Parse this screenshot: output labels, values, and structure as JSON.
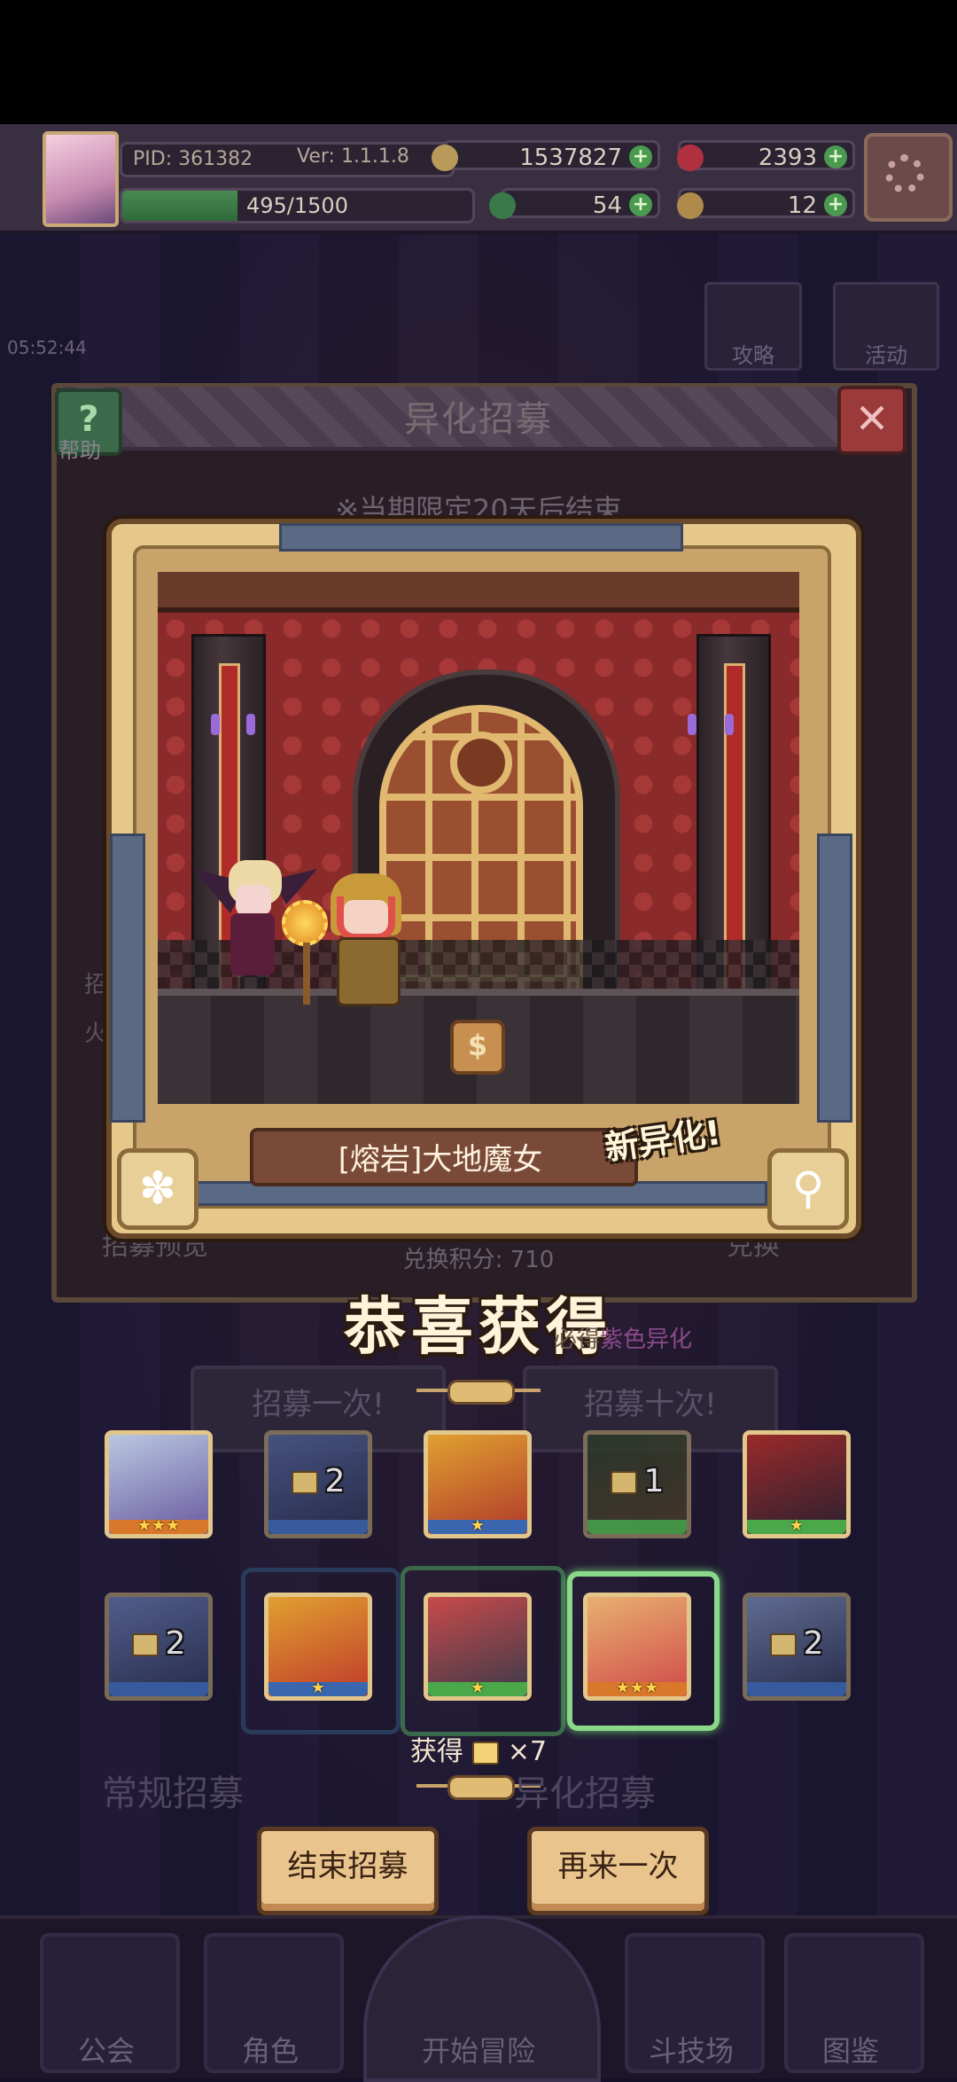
{
  "header": {
    "pid": "PID: 361382",
    "version": "Ver: 1.1.1.8",
    "coins": "1537827",
    "gems": "2393",
    "energy_text": "495/1500",
    "energy_fraction": 0.33,
    "clovers": "54",
    "potions": "12"
  },
  "background": {
    "clock": "05:52:44",
    "guide_label": "攻略",
    "event_label": "活动"
  },
  "modal": {
    "title": "异化招募",
    "help_label": "帮助",
    "period_note": "※当期限定20天后结束",
    "side_text_a": "招",
    "side_text_b": "火",
    "preview_label": "招募预览",
    "exchange_label": "兑换",
    "points": "兑换积分: 710",
    "guarantee_prefix": "必得",
    "guarantee_accent": "紫色异化",
    "once_label": "招募一次!",
    "ten_label": "招募十次!"
  },
  "showcase": {
    "character_name": "[熔岩]大地魔女",
    "new_tag": "新异化!",
    "coin_glyph": "$",
    "paw_glyph": "✽",
    "key_glyph": "⚲"
  },
  "result": {
    "congrats": "恭喜获得",
    "obtain_prefix": "获得",
    "obtain_suffix": "×7",
    "cards_row1": [
      {
        "stars": "★★★",
        "count": "",
        "rarity": "orange"
      },
      {
        "stars": "",
        "count": "2",
        "rarity": "blue"
      },
      {
        "stars": "★",
        "count": "",
        "rarity": "blue"
      },
      {
        "stars": "",
        "count": "1",
        "rarity": "green"
      },
      {
        "stars": "★",
        "count": "",
        "rarity": "green"
      }
    ],
    "cards_row2": [
      {
        "stars": "",
        "count": "2",
        "rarity": "blue"
      },
      {
        "stars": "★",
        "count": "",
        "rarity": "blue"
      },
      {
        "stars": "★",
        "count": "",
        "rarity": "green"
      },
      {
        "stars": "★★★",
        "count": "",
        "rarity": "orange"
      },
      {
        "stars": "",
        "count": "2",
        "rarity": "blue"
      }
    ]
  },
  "actions": {
    "end_label": "结束招募",
    "again_label": "再来一次"
  },
  "ghost_sections": {
    "regular_label": "常规招募",
    "mutant_label": "异化招募"
  },
  "nav": {
    "guild": "公会",
    "character": "角色",
    "adventure": "开始冒险",
    "arena": "斗技场",
    "codex": "图鉴"
  }
}
